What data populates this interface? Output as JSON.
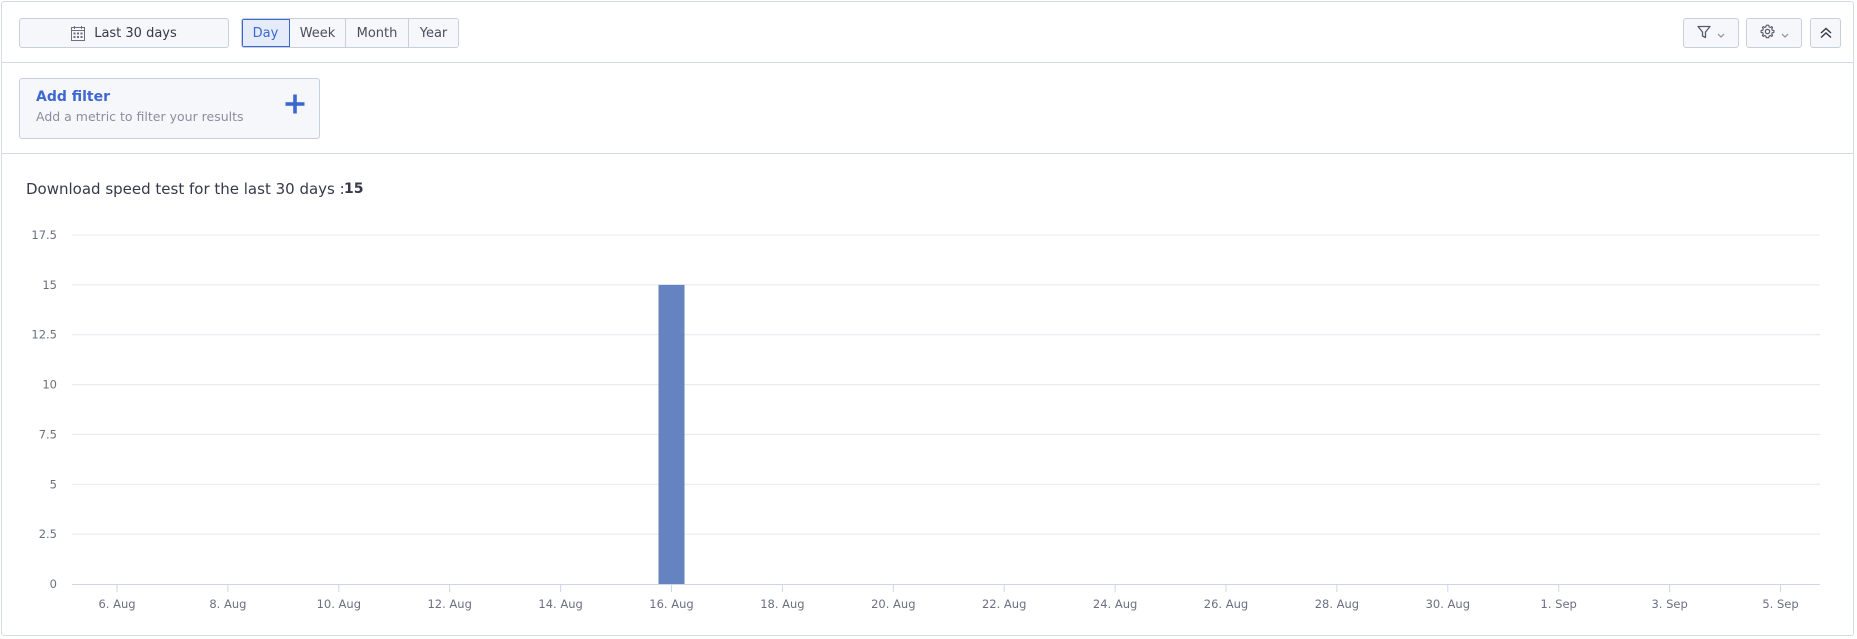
{
  "toolbar": {
    "date_range_label": "Last 30 days",
    "periods": [
      "Day",
      "Week",
      "Month",
      "Year"
    ],
    "active_period": "Day"
  },
  "filter": {
    "title": "Add filter",
    "subtitle": "Add a metric to filter your results"
  },
  "summary": {
    "label": "Download speed test for the last 30 days :",
    "count": "15"
  },
  "chart_data": {
    "type": "bar",
    "title": "",
    "xlabel": "",
    "ylabel": "",
    "ylim": [
      0,
      17.5
    ],
    "yticks": [
      0,
      2.5,
      5,
      7.5,
      10,
      12.5,
      15,
      17.5
    ],
    "x_tick_labels": [
      "6. Aug",
      "8. Aug",
      "10. Aug",
      "12. Aug",
      "14. Aug",
      "16. Aug",
      "18. Aug",
      "20. Aug",
      "22. Aug",
      "24. Aug",
      "26. Aug",
      "28. Aug",
      "30. Aug",
      "1. Sep",
      "3. Sep",
      "5. Sep"
    ],
    "bars": [
      {
        "x": "16. Aug",
        "value": 15
      }
    ],
    "grid": true,
    "bar_color": "#6583c0"
  },
  "colors": {
    "accent": "#3d68d1",
    "bar": "#6583c0",
    "grid": "#e6e8ee"
  }
}
